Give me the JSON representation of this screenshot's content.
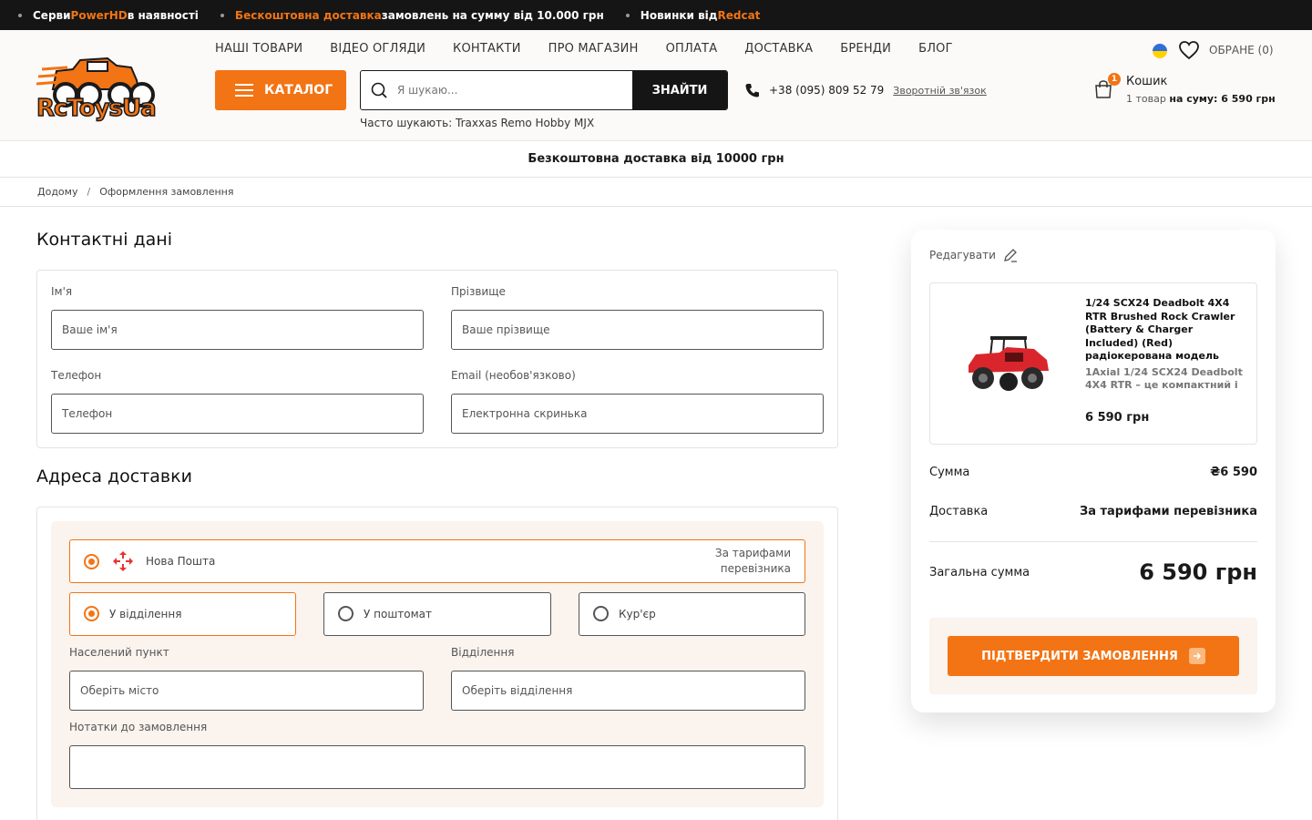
{
  "topbar": {
    "item1_pre": "Серви ",
    "item1_brand": "PowerHD",
    "item1_post": " в наявності",
    "item2_orange": "Бескоштовна доставка",
    "item2_rest": " замовлень на сумму від 10.000 грн",
    "item3_pre": "Новинки від ",
    "item3_brand": "Redcat"
  },
  "header": {
    "logo_text": "RcToysUa",
    "nav": [
      "НАШІ ТОВАРИ",
      "ВІДЕО ОГЛЯДИ",
      "КОНТАКТИ",
      "ПРО МАГАЗИН",
      "ОПЛАТА",
      "ДОСТАВКА",
      "БРЕНДИ",
      "БЛОГ"
    ],
    "catalog_label": "КАТАЛОГ",
    "search_placeholder": "Я шукаю...",
    "search_button": "ЗНАЙТИ",
    "hint": "Часто шукають: Traxxas Remo Hobby MJX",
    "phone": "+38 (095) 809 52 79",
    "callback": "Зворотній зв'язок",
    "favorites": "ОБРАНЕ (0)",
    "cart_count": "1",
    "cart_title": "Кошик",
    "cart_sum_pre": "1 товар ",
    "cart_sum_bold": "на суму: 6 590 грн"
  },
  "promo": "Безкоштовна доставка від 10000 грн",
  "breadcrumbs": [
    "Додому",
    "Оформлення замовлення"
  ],
  "contacts": {
    "title": "Контактні дані",
    "first_name_label": "Ім'я",
    "first_name_placeholder": "Ваше ім'я",
    "last_name_label": "Прізвище",
    "last_name_placeholder": "Ваше прізвище",
    "phone_label": "Телефон",
    "phone_placeholder": "Телефон",
    "email_label": "Email (необов'язково)",
    "email_placeholder": "Електронна скринька"
  },
  "delivery": {
    "title": "Адреса доставки",
    "carrier": "Нова Пошта",
    "carrier_price_line1": "За тарифами",
    "carrier_price_line2": "перевізника",
    "options": [
      "У відділення",
      "У поштомат",
      "Кур'єр"
    ],
    "city_label": "Населений пункт",
    "city_placeholder": "Оберіть місто",
    "branch_label": "Відділення",
    "branch_placeholder": "Оберіть відділення",
    "notes_label": "Нотатки до замовлення",
    "notes_value": ""
  },
  "summary": {
    "edit_label": "Редагувати",
    "product_title": "1/24 SCX24 Deadbolt 4X4 RTR Brushed Rock Crawler (Battery & Charger Included) (Red) радіокерована модель",
    "product_desc": "1Axial 1/24 SCX24 Deadbolt 4X4 RTR – це компактний і",
    "product_price": "6 590 грн",
    "sum_label": "Сумма",
    "sum_value": "₴6 590",
    "delivery_label": "Доставка",
    "delivery_value": "За тарифами перевізника",
    "total_label": "Загальна сумма",
    "total_value": "6 590 грн",
    "confirm_label": "ПІДТВЕРДИТИ ЗАМОВЛЕННЯ"
  },
  "colors": {
    "accent": "#f27414",
    "dark": "#151515",
    "soft_bg": "#faf3ee"
  }
}
